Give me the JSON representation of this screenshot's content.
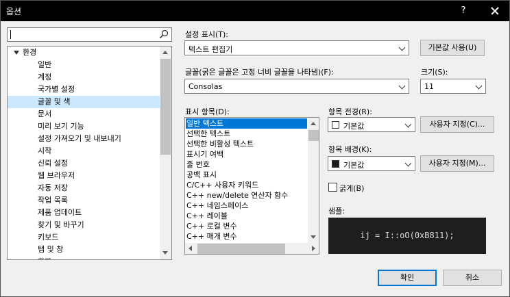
{
  "window": {
    "title": "옵션",
    "help": "?"
  },
  "search": {
    "value": ""
  },
  "tree": {
    "root": "환경",
    "items": [
      "일반",
      "계정",
      "국가별 설정",
      "글꼴 및 색",
      "문서",
      "미리 보기 기능",
      "설정 가져오기 및 내보내기",
      "시작",
      "신뢰 설정",
      "웹 브라우저",
      "자동 저장",
      "작업 목록",
      "제품 업데이트",
      "찾기 및 바꾸기",
      "키보드",
      "탭 및 창",
      "확장"
    ],
    "selected": "글꼴 및 색"
  },
  "show_settings": {
    "label": "설정 표시(T):",
    "value": "텍스트 편집기"
  },
  "default_button": "기본값 사용(U)",
  "font": {
    "label": "글꼴(굵은 글꼴은 고정 너비 글꼴을 나타냄)(F):",
    "value": "Consolas"
  },
  "size": {
    "label": "크기(S):",
    "value": "11"
  },
  "display_items": {
    "label": "표시 항목(D):",
    "items": [
      "일반 텍스트",
      "선택한 텍스트",
      "선택한 비활성 텍스트",
      "표시기 여백",
      "줄 번호",
      "공백 표시",
      "C/C++ 사용자 키워드",
      "C++ new/delete 연산자 함수",
      "C++ 네임스페이스",
      "C++ 레이블",
      "C++ 로컬 변수",
      "C++ 매개 변수"
    ],
    "selected": "일반 텍스트"
  },
  "foreground": {
    "label": "항목 전경(R):",
    "value": "기본값",
    "swatch": "#ffffff",
    "custom_button": "사용자 지정(C)..."
  },
  "background": {
    "label": "항목 배경(K):",
    "value": "기본값",
    "swatch": "#1e1e1e",
    "custom_button": "사용자 지정(M)..."
  },
  "bold": {
    "label": "굵게(B)",
    "checked": false
  },
  "sample": {
    "label": "샘플:",
    "text": "ij = I::oO(0xB811);"
  },
  "footer": {
    "ok": "확인",
    "cancel": "취소"
  }
}
